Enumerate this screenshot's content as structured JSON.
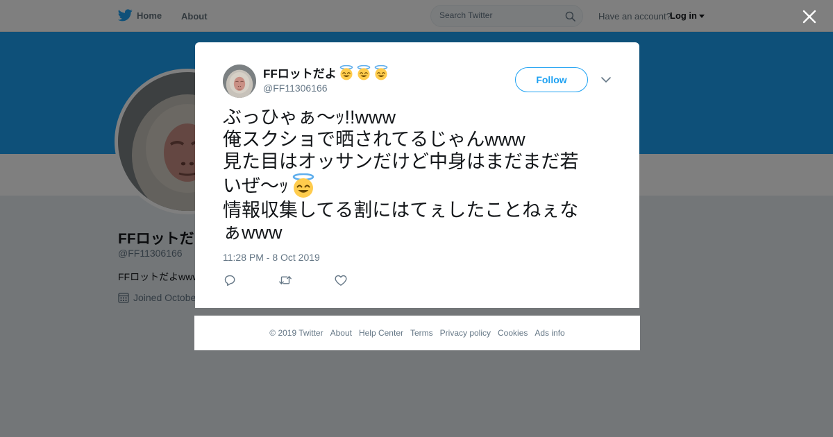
{
  "nav": {
    "home_label": "Home",
    "about_label": "About",
    "search_placeholder": "Search Twitter",
    "account_prompt": "Have an account?",
    "login_label": "Log in"
  },
  "profile": {
    "name": "FFロットだよ",
    "handle": "@FF11306166",
    "bio": "FFロットだよwww",
    "joined": "Joined Octobe"
  },
  "tweet": {
    "author_name": "FFロットだよ",
    "author_handle": "@FF11306166",
    "follow_label": "Follow",
    "lines": [
      "ぶっひゃぁ〜ｯ!!www",
      "俺スクショで晒されてるじゃんwww",
      "見た目はオッサンだけど中身はまだまだ若",
      "いぜ〜ｯ",
      "情報収集してる割にはてぇしたことねぇな",
      "ぁwww"
    ],
    "timestamp": "11:28 PM - 8 Oct 2019"
  },
  "footer": {
    "copyright": "© 2019 Twitter",
    "links": [
      "About",
      "Help Center",
      "Terms",
      "Privacy policy",
      "Cookies",
      "Ads info"
    ]
  },
  "colors": {
    "accent": "#1da1f2",
    "overlay": "rgba(0,0,0,0.5)",
    "secondary_text": "#657786"
  },
  "icons": [
    "twitter-bird-icon",
    "search-icon",
    "close-icon",
    "chevron-down-icon",
    "reply-icon",
    "retweet-icon",
    "like-icon",
    "calendar-icon",
    "smiling-face-with-halo-emoji"
  ]
}
